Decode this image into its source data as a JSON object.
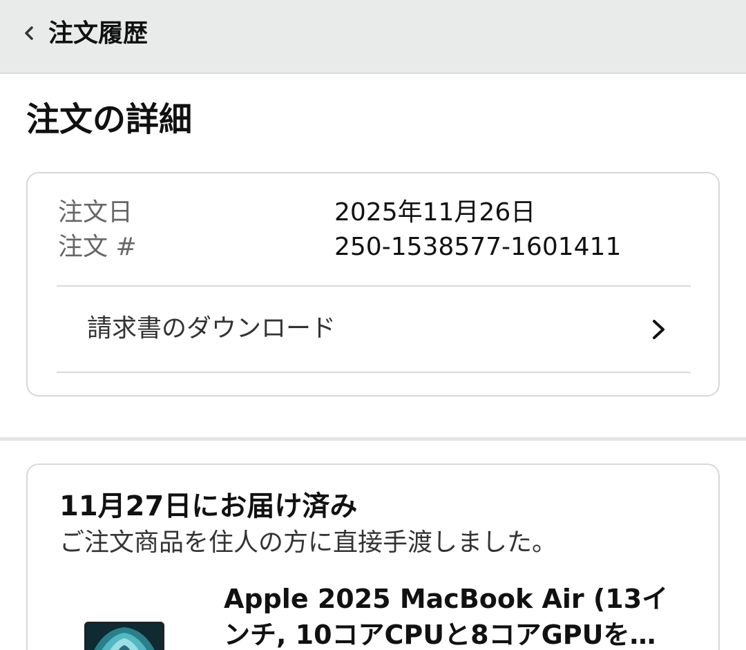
{
  "header": {
    "back_label": "注文履歴"
  },
  "page": {
    "title": "注文の詳細"
  },
  "order": {
    "date_label": "注文日",
    "date_value": "2025年11月26日",
    "number_label": "注文 #",
    "number_value": "250-1538577-1601411",
    "invoice_label": "請求書のダウンロード"
  },
  "delivery": {
    "status": "11月27日にお届け済み",
    "note": "ご注文商品を住人の方に直接手渡しました。",
    "product_title": "Apple 2025 MacBook Air (13インチ, 10コアCPUと8コアGPUを…"
  },
  "icons": {
    "back": "chevron-left-icon",
    "invoice_chevron": "chevron-right-icon"
  },
  "colors": {
    "header_bg": "#e9eaea",
    "card_border": "#d7d7d7",
    "label_gray": "#666666"
  }
}
